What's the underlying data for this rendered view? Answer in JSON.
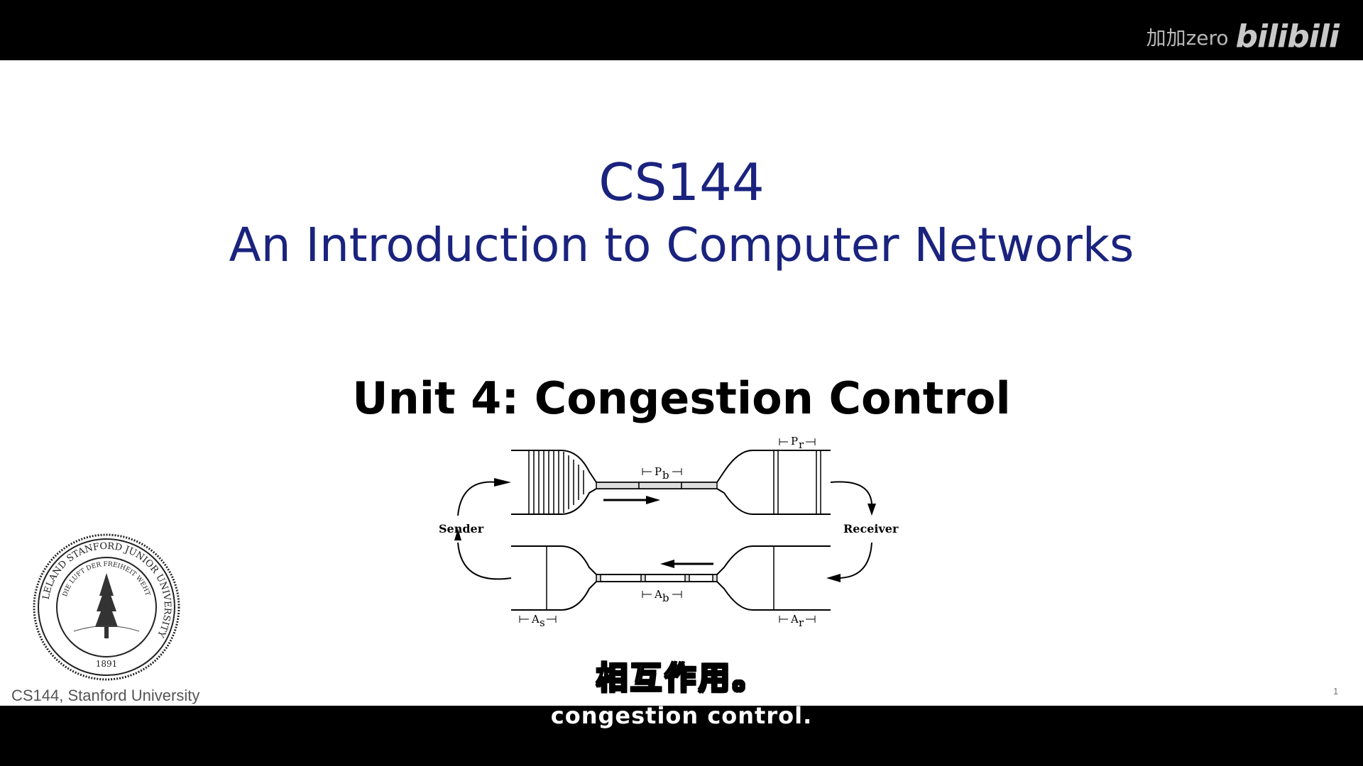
{
  "watermark": {
    "user": "加加zero",
    "logo": "bilibili"
  },
  "slide": {
    "course_code": "CS144",
    "course_title": "An Introduction to Computer Networks",
    "unit_title": "Unit 4: Congestion Control",
    "footer": "CS144, Stanford University",
    "page_number": "1"
  },
  "diagram": {
    "sender_label": "Sender",
    "receiver_label": "Receiver",
    "pb_label": "P",
    "pb_sub": "b",
    "pr_label": "P",
    "pr_sub": "r",
    "ab_label": "A",
    "ab_sub": "b",
    "as_label": "A",
    "as_sub": "s",
    "ar_label": "A",
    "ar_sub": "r"
  },
  "seal": {
    "ring_text": "LELAND STANFORD JUNIOR UNIVERSITY",
    "motto": "DIE LUFT DER FREIHEIT WEHT",
    "year": "1891"
  },
  "subtitles": {
    "chinese": "相互作用。",
    "english": "congestion control."
  }
}
